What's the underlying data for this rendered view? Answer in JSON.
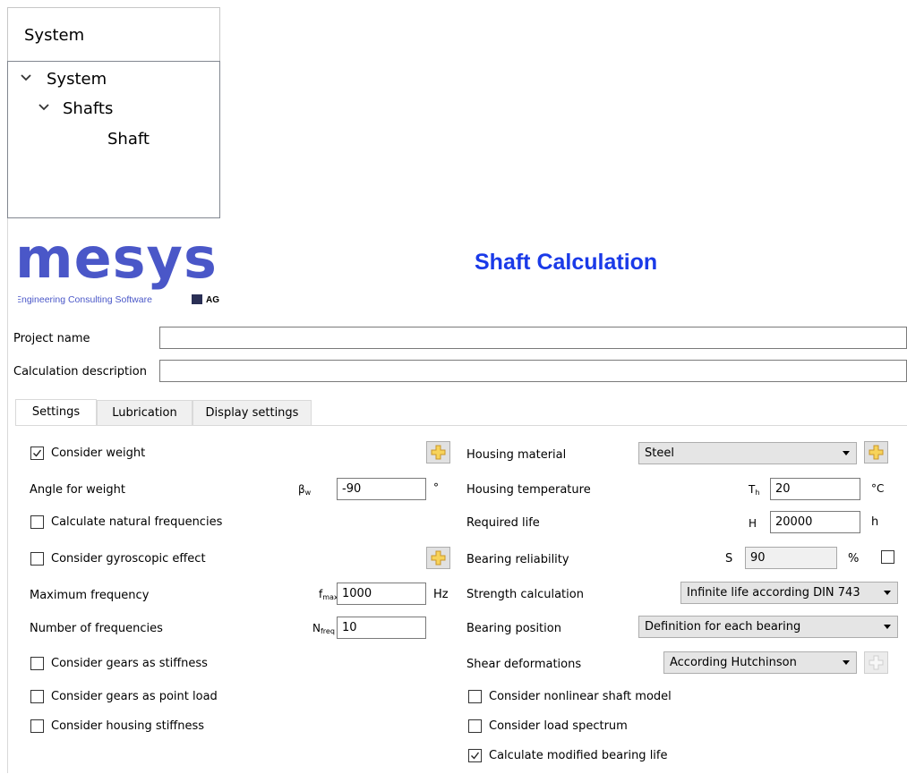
{
  "tree": {
    "header": "System",
    "items": [
      {
        "label": "System",
        "expanded": true
      },
      {
        "label": "Shafts",
        "expanded": true
      },
      {
        "label": "Shaft"
      }
    ]
  },
  "logo": {
    "word": "mesys",
    "tagline": "Engineering Consulting Software",
    "suffix": "AG"
  },
  "title": "Shaft Calculation",
  "project": {
    "name_label": "Project name",
    "name_value": "",
    "desc_label": "Calculation description",
    "desc_value": ""
  },
  "tabs": [
    "Settings",
    "Lubrication",
    "Display settings"
  ],
  "active_tab": "Settings",
  "left": {
    "consider_weight": {
      "label": "Consider weight",
      "checked": true
    },
    "angle_weight": {
      "label": "Angle for weight",
      "symbol": "β",
      "symbol_sub": "w",
      "value": "-90",
      "unit": "°"
    },
    "natural_freq": {
      "label": "Calculate natural frequencies",
      "checked": false
    },
    "gyroscopic": {
      "label": "Consider gyroscopic effect",
      "checked": false
    },
    "max_freq": {
      "label": "Maximum frequency",
      "symbol": "f",
      "symbol_sub": "max",
      "value": "1000",
      "unit": "Hz"
    },
    "num_freq": {
      "label": "Number of frequencies",
      "symbol": "N",
      "symbol_sub": "freq",
      "value": "10"
    },
    "gears_stiffness": {
      "label": "Consider gears as stiffness",
      "checked": false
    },
    "gears_point_load": {
      "label": "Consider gears as point load",
      "checked": false
    },
    "housing_stiffness": {
      "label": "Consider housing stiffness",
      "checked": false
    }
  },
  "right": {
    "housing_material": {
      "label": "Housing material",
      "value": "Steel"
    },
    "housing_temp": {
      "label": "Housing temperature",
      "symbol": "T",
      "symbol_sub": "h",
      "value": "20",
      "unit": "°C"
    },
    "required_life": {
      "label": "Required life",
      "symbol": "H",
      "value": "20000",
      "unit": "h"
    },
    "bearing_reliability": {
      "label": "Bearing reliability",
      "symbol": "S",
      "value": "90",
      "unit": "%",
      "checked": false
    },
    "strength_calc": {
      "label": "Strength calculation",
      "value": "Infinite life according DIN 743"
    },
    "bearing_position": {
      "label": "Bearing position",
      "value": "Definition for each bearing"
    },
    "shear_deformations": {
      "label": "Shear deformations",
      "value": "According Hutchinson"
    },
    "nonlinear_shaft": {
      "label": "Consider nonlinear shaft model",
      "checked": false
    },
    "load_spectrum": {
      "label": "Consider load spectrum",
      "checked": false
    },
    "modified_life": {
      "label": "Calculate modified bearing life",
      "checked": true
    }
  },
  "colors": {
    "title": "#1a3ae8",
    "logo": "#4a57c8",
    "plus_icon": "#f2c94c"
  }
}
